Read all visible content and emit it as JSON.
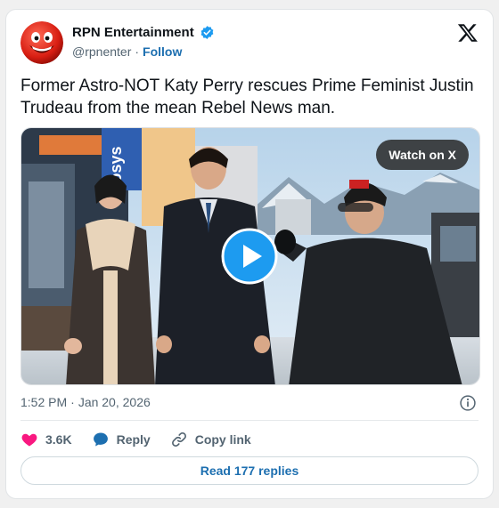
{
  "tweet": {
    "author": {
      "display_name": "RPN Entertainment",
      "handle": "@rpnenter",
      "separator": "·",
      "follow_label": "Follow",
      "avatar_icon": "smiley-face-icon",
      "verified_icon": "verified-badge-icon"
    },
    "platform_logo": "x-logo-icon",
    "text": "Former Astro-NOT Katy Perry rescues Prime Feminist Justin Trudeau from the mean Rebel News man.",
    "media": {
      "watch_label": "Watch on X",
      "play_icon": "play-icon",
      "sign_text": "Infosys"
    },
    "meta": {
      "time": "1:52 PM",
      "separator": "·",
      "date": "Jan 20, 2026"
    },
    "actions": {
      "likes_count": "3.6K",
      "reply_label": "Reply",
      "copy_link_label": "Copy link"
    },
    "read_replies_label": "Read 177 replies"
  },
  "colors": {
    "accent": "#1d6fb0",
    "verified": "#1d9bf0",
    "heart": "#f91880",
    "muted": "#536471"
  }
}
